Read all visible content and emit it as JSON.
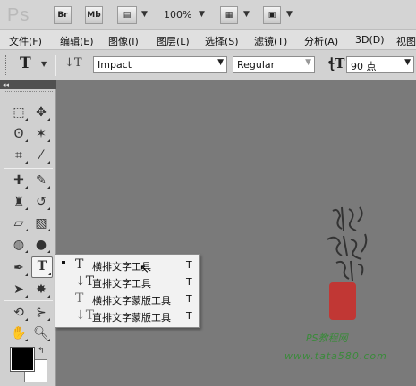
{
  "app": {
    "logo": "Ps"
  },
  "titlebar": {
    "bridge_label": "Br",
    "minibridge_label": "Mb",
    "zoom_value": "100%"
  },
  "menu": {
    "items": [
      "文件(F)",
      "编辑(E)",
      "图像(I)",
      "图层(L)",
      "选择(S)",
      "滤镜(T)",
      "分析(A)",
      "3D(D)",
      "视图"
    ]
  },
  "options": {
    "font_family": "Impact",
    "font_style": "Regular",
    "font_size": "90 点"
  },
  "tools_panel": {
    "collapse_glyph": "◂◂"
  },
  "flyout": {
    "items": [
      {
        "label": "横排文字工具",
        "shortcut": "T",
        "selected": true
      },
      {
        "label": "直排文字工具",
        "shortcut": "T",
        "selected": false
      },
      {
        "label": "横排文字蒙版工具",
        "shortcut": "T",
        "selected": false
      },
      {
        "label": "直排文字蒙版工具",
        "shortcut": "T",
        "selected": false
      }
    ]
  },
  "watermark": {
    "site": "PS教程网",
    "url": "www.tata580.com"
  },
  "colors": {
    "workspace": "#7a7a7a",
    "foreground": "#000000",
    "background": "#ffffff",
    "watermark_green": "#3a8a3a",
    "seal_red": "#c9302c"
  }
}
